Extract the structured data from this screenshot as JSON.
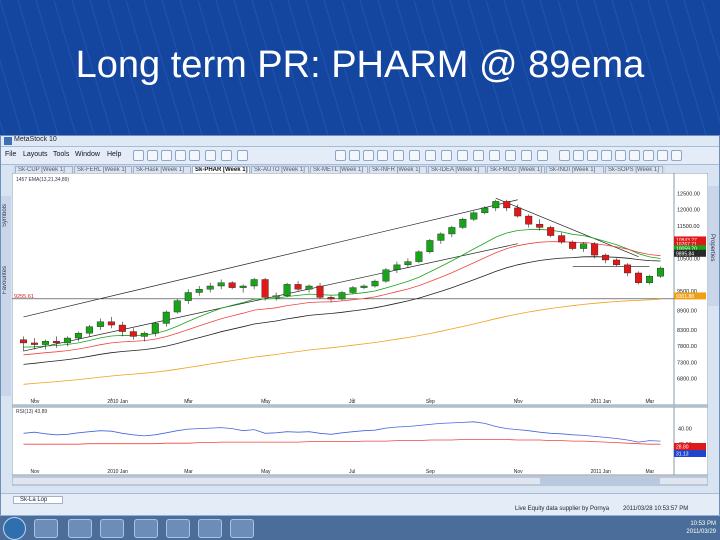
{
  "slide": {
    "title": "Long term PR: PHARM @ 89ema"
  },
  "window": {
    "title": "MetaStock 10"
  },
  "menu": [
    "File",
    "Layouts",
    "Tools",
    "Window",
    "Help"
  ],
  "tabs": [
    "Sk-CUP [Week 1]",
    "Sk-FERL [Week 1]",
    "Sk-Hask [Week 1]",
    "Sk-PHAR [Week 1]",
    "Sk-AUTO [Week 1]",
    "Sk-METL [Week 1]",
    "Sk-INFR [Week 1]",
    "Sk-IDEA [Week 1]",
    "Sk-FMCG [Week 1]",
    "Sk-INDI [Week 1]",
    "Sk-SOPS [Week 1]"
  ],
  "active_tab_index": 3,
  "left_sidebar": [
    "Symbols",
    "Favourites"
  ],
  "right_sidebar": "Properties",
  "statusbar": {
    "tab": "Sk-La Lop",
    "source": "Live Equity data supplier by Pornya",
    "timestamp": "2011/03/28 10:53:57 PM"
  },
  "taskbar": {
    "time": "10:53 PM",
    "date": "2011/03/29"
  },
  "icons": {
    "start": "windows-start-orb",
    "taskbar": [
      "word-icon",
      "explorer-folder-icon",
      "media-player-icon",
      "paint-icon",
      "skype-icon",
      "metastock-icon",
      "files-icon"
    ]
  },
  "colors": {
    "price_up": "#18a418",
    "price_down": "#e01818",
    "ema_short": "#18a418",
    "ema_mid": "#ee4444",
    "ema_long": "#222222",
    "ema_89": "#f0a018",
    "channel": "#222222",
    "indicator": "#4466dd",
    "indicator_avg": "#ee4444"
  },
  "chart_data": {
    "type": "candlestick",
    "symbol_label": "1457 EMA(13,21,34,89)",
    "price_label": "9255.61",
    "y_ticks": [
      "12500.00",
      "12000.00",
      "11500.00",
      "11000.00",
      "10500.00",
      "9500.00",
      "8900.00",
      "8300.00",
      "7800.00",
      "7300.00",
      "6800.00"
    ],
    "right_badges": [
      {
        "value": "10843.27",
        "color": "#e01818"
      },
      {
        "value": "10767.71",
        "color": "#e01818"
      },
      {
        "value": "10059.70",
        "color": "#18a418"
      },
      {
        "value": "9895.84",
        "color": "#2a2a2a"
      },
      {
        "value": "9301.88",
        "color": "#f0a018"
      }
    ],
    "x_ticks": [
      "Nov",
      "2010 Jan",
      "Mar",
      "May",
      "Jul",
      "Sep",
      "Nov",
      "2011 Jan",
      "Mar"
    ],
    "ylim": [
      6300,
      13000
    ],
    "candles": [
      [
        8000,
        8100,
        7650,
        7900
      ],
      [
        7900,
        8050,
        7700,
        7850
      ],
      [
        7850,
        8000,
        7700,
        7950
      ],
      [
        7950,
        8100,
        7750,
        7900
      ],
      [
        7900,
        8100,
        7800,
        8050
      ],
      [
        8050,
        8250,
        7950,
        8200
      ],
      [
        8200,
        8450,
        8100,
        8400
      ],
      [
        8400,
        8650,
        8300,
        8550
      ],
      [
        8550,
        8700,
        8350,
        8450
      ],
      [
        8450,
        8550,
        8100,
        8250
      ],
      [
        8250,
        8350,
        8000,
        8100
      ],
      [
        8100,
        8250,
        7950,
        8200
      ],
      [
        8200,
        8550,
        8100,
        8500
      ],
      [
        8500,
        8900,
        8400,
        8850
      ],
      [
        8850,
        9250,
        8800,
        9200
      ],
      [
        9200,
        9550,
        9100,
        9450
      ],
      [
        9450,
        9650,
        9350,
        9550
      ],
      [
        9550,
        9750,
        9450,
        9650
      ],
      [
        9650,
        9850,
        9550,
        9750
      ],
      [
        9750,
        9800,
        9550,
        9600
      ],
      [
        9600,
        9700,
        9450,
        9650
      ],
      [
        9650,
        9900,
        9550,
        9850
      ],
      [
        9850,
        9900,
        9200,
        9300
      ],
      [
        9300,
        9450,
        9200,
        9350
      ],
      [
        9350,
        9750,
        9300,
        9700
      ],
      [
        9700,
        9800,
        9500,
        9550
      ],
      [
        9550,
        9700,
        9450,
        9650
      ],
      [
        9650,
        9750,
        9250,
        9300
      ],
      [
        9300,
        9350,
        9150,
        9250
      ],
      [
        9250,
        9500,
        9200,
        9450
      ],
      [
        9450,
        9650,
        9400,
        9600
      ],
      [
        9600,
        9700,
        9550,
        9650
      ],
      [
        9650,
        9850,
        9600,
        9800
      ],
      [
        9800,
        10200,
        9750,
        10150
      ],
      [
        10150,
        10400,
        10050,
        10300
      ],
      [
        10300,
        10500,
        10200,
        10400
      ],
      [
        10400,
        10750,
        10350,
        10700
      ],
      [
        10700,
        11100,
        10650,
        11050
      ],
      [
        11050,
        11300,
        10950,
        11250
      ],
      [
        11250,
        11500,
        11150,
        11450
      ],
      [
        11450,
        11750,
        11400,
        11700
      ],
      [
        11700,
        11950,
        11650,
        11900
      ],
      [
        11900,
        12100,
        11850,
        12050
      ],
      [
        12050,
        12300,
        11950,
        12250
      ],
      [
        12250,
        12300,
        11950,
        12050
      ],
      [
        12050,
        12150,
        11750,
        11800
      ],
      [
        11800,
        11850,
        11450,
        11550
      ],
      [
        11550,
        11700,
        11350,
        11450
      ],
      [
        11450,
        11500,
        11150,
        11200
      ],
      [
        11200,
        11300,
        10950,
        11000
      ],
      [
        11000,
        11050,
        10750,
        10800
      ],
      [
        10800,
        11000,
        10700,
        10950
      ],
      [
        10950,
        11000,
        10500,
        10600
      ],
      [
        10600,
        10650,
        10350,
        10450
      ],
      [
        10450,
        10500,
        10250,
        10300
      ],
      [
        10300,
        10350,
        9950,
        10050
      ],
      [
        10050,
        10100,
        9700,
        9750
      ],
      [
        9750,
        10000,
        9700,
        9950
      ],
      [
        9950,
        10250,
        9900,
        10200
      ]
    ],
    "indicator": {
      "label": "RSI(13) 43.89",
      "y_ticks": [
        "40.00",
        "45.00"
      ],
      "badges": [
        {
          "value": "28.80",
          "color": "#e01818"
        },
        {
          "value": "31.13",
          "color": "#2244cc"
        }
      ],
      "ylim": [
        0,
        100
      ],
      "values": [
        61,
        63,
        60,
        58,
        59,
        62,
        64,
        66,
        65,
        61,
        58,
        56,
        58,
        62,
        66,
        69,
        70,
        71,
        72,
        70,
        66,
        68,
        61,
        62,
        64,
        63,
        64,
        61,
        59,
        62,
        64,
        66,
        67,
        71,
        73,
        74,
        76,
        78,
        80,
        81,
        82,
        83,
        80,
        74,
        70,
        68,
        66,
        63,
        61,
        60,
        58,
        57,
        55,
        53,
        51,
        48,
        44,
        47,
        46
      ],
      "avg": [
        60,
        60,
        60,
        60,
        60,
        60,
        61,
        61,
        61,
        61,
        61,
        61,
        61,
        62,
        62,
        62,
        63,
        63,
        64,
        64,
        64,
        64,
        64,
        64,
        64,
        64,
        65,
        65,
        65,
        65,
        65,
        66,
        66,
        66,
        67,
        67,
        67,
        68,
        68,
        68,
        69,
        69,
        69,
        69,
        69,
        68,
        68,
        68,
        67,
        67,
        66,
        66,
        65,
        64,
        63,
        62,
        61,
        60,
        60
      ]
    }
  }
}
